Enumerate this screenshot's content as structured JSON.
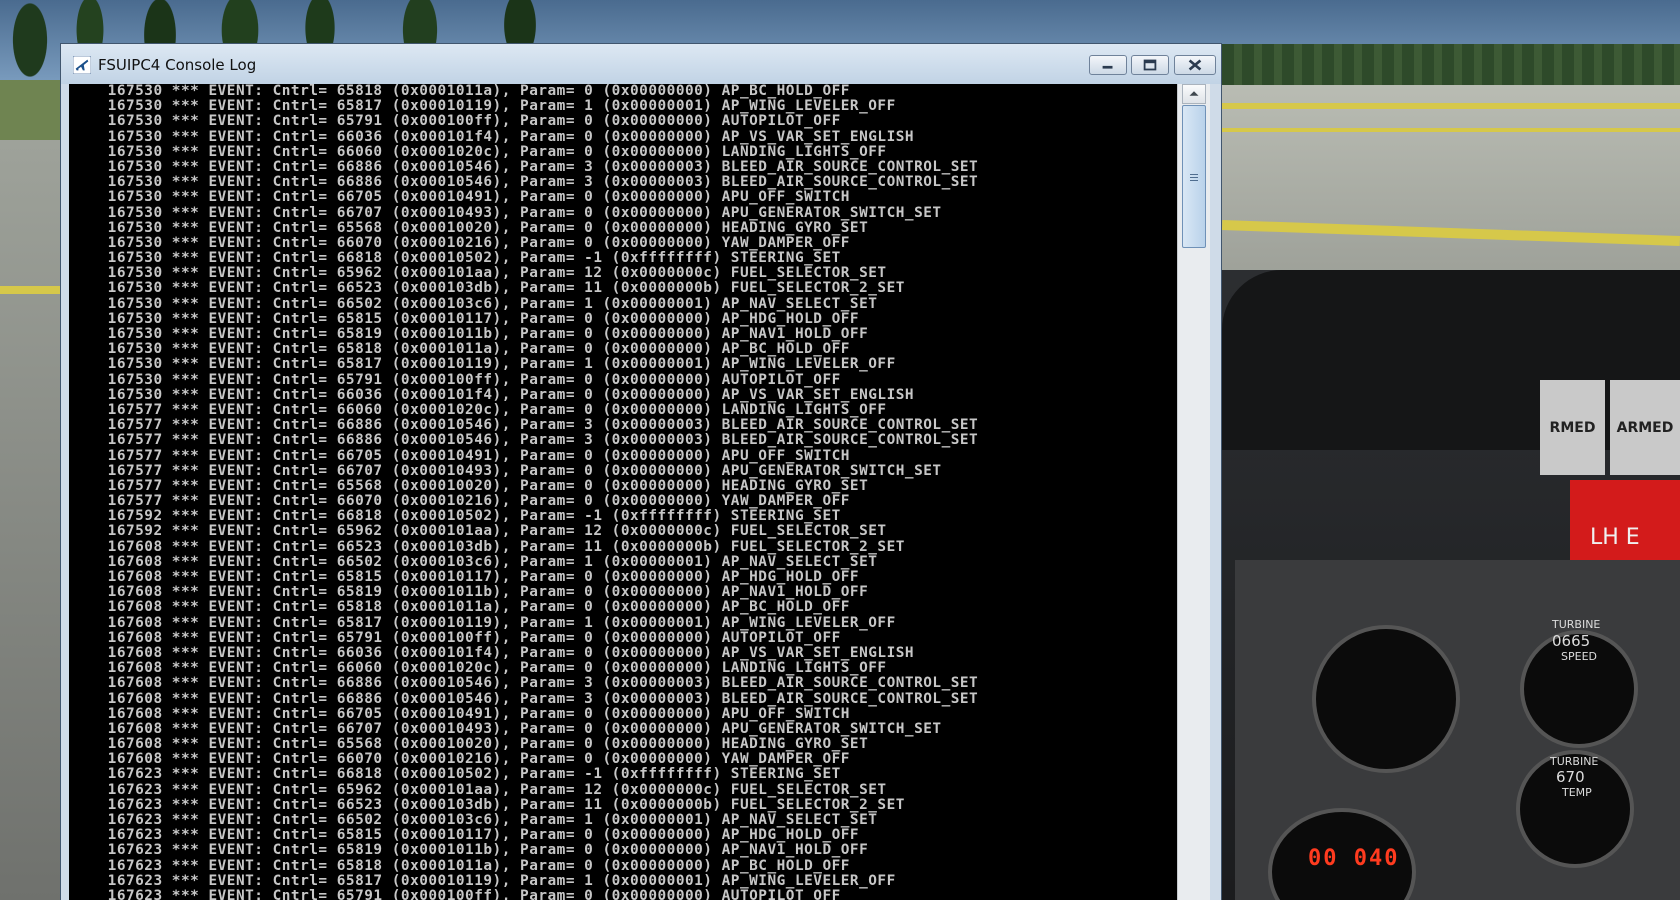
{
  "window": {
    "title": "FSUIPC4 Console Log",
    "icon": "airplane-icon",
    "controls": [
      "minimize-icon",
      "maximize-icon",
      "close-icon"
    ]
  },
  "background": {
    "panel_labels": {
      "armed_left": "RMED",
      "armed_right": "ARMED",
      "lh": "LH E",
      "gauge_turbine_speed": "TURBINE",
      "gauge_turbine_speed_sub": "SPEED",
      "gauge_turbine_speed_counter": "0665",
      "gauge_turbine_temp": "TURBINE",
      "gauge_turbine_temp_value": "670",
      "gauge_turbine_temp_sub": "TEMP",
      "altimeter_readout": "00 040"
    }
  },
  "console": {
    "lines": [
      "    167530 *** EVENT: Cntrl= 65818 (0x0001011a), Param= 0 (0x00000000) AP_BC_HOLD_OFF",
      "    167530 *** EVENT: Cntrl= 65817 (0x00010119), Param= 1 (0x00000001) AP_WING_LEVELER_OFF",
      "    167530 *** EVENT: Cntrl= 65791 (0x000100ff), Param= 0 (0x00000000) AUTOPILOT_OFF",
      "    167530 *** EVENT: Cntrl= 66036 (0x000101f4), Param= 0 (0x00000000) AP_VS_VAR_SET_ENGLISH",
      "    167530 *** EVENT: Cntrl= 66060 (0x0001020c), Param= 0 (0x00000000) LANDING_LIGHTS_OFF",
      "    167530 *** EVENT: Cntrl= 66886 (0x00010546), Param= 3 (0x00000003) BLEED_AIR_SOURCE_CONTROL_SET",
      "    167530 *** EVENT: Cntrl= 66886 (0x00010546), Param= 3 (0x00000003) BLEED_AIR_SOURCE_CONTROL_SET",
      "    167530 *** EVENT: Cntrl= 66705 (0x00010491), Param= 0 (0x00000000) APU_OFF_SWITCH",
      "    167530 *** EVENT: Cntrl= 66707 (0x00010493), Param= 0 (0x00000000) APU_GENERATOR_SWITCH_SET",
      "    167530 *** EVENT: Cntrl= 65568 (0x00010020), Param= 0 (0x00000000) HEADING_GYRO_SET",
      "    167530 *** EVENT: Cntrl= 66070 (0x00010216), Param= 0 (0x00000000) YAW_DAMPER_OFF",
      "    167530 *** EVENT: Cntrl= 66818 (0x00010502), Param= -1 (0xffffffff) STEERING_SET",
      "    167530 *** EVENT: Cntrl= 65962 (0x000101aa), Param= 12 (0x0000000c) FUEL_SELECTOR_SET",
      "    167530 *** EVENT: Cntrl= 66523 (0x000103db), Param= 11 (0x0000000b) FUEL_SELECTOR_2_SET",
      "    167530 *** EVENT: Cntrl= 66502 (0x000103c6), Param= 1 (0x00000001) AP_NAV_SELECT_SET",
      "    167530 *** EVENT: Cntrl= 65815 (0x00010117), Param= 0 (0x00000000) AP_HDG_HOLD_OFF",
      "    167530 *** EVENT: Cntrl= 65819 (0x0001011b), Param= 0 (0x00000000) AP_NAV1_HOLD_OFF",
      "    167530 *** EVENT: Cntrl= 65818 (0x0001011a), Param= 0 (0x00000000) AP_BC_HOLD_OFF",
      "    167530 *** EVENT: Cntrl= 65817 (0x00010119), Param= 1 (0x00000001) AP_WING_LEVELER_OFF",
      "    167530 *** EVENT: Cntrl= 65791 (0x000100ff), Param= 0 (0x00000000) AUTOPILOT_OFF",
      "    167530 *** EVENT: Cntrl= 66036 (0x000101f4), Param= 0 (0x00000000) AP_VS_VAR_SET_ENGLISH",
      "    167577 *** EVENT: Cntrl= 66060 (0x0001020c), Param= 0 (0x00000000) LANDING_LIGHTS_OFF",
      "    167577 *** EVENT: Cntrl= 66886 (0x00010546), Param= 3 (0x00000003) BLEED_AIR_SOURCE_CONTROL_SET",
      "    167577 *** EVENT: Cntrl= 66886 (0x00010546), Param= 3 (0x00000003) BLEED_AIR_SOURCE_CONTROL_SET",
      "    167577 *** EVENT: Cntrl= 66705 (0x00010491), Param= 0 (0x00000000) APU_OFF_SWITCH",
      "    167577 *** EVENT: Cntrl= 66707 (0x00010493), Param= 0 (0x00000000) APU_GENERATOR_SWITCH_SET",
      "    167577 *** EVENT: Cntrl= 65568 (0x00010020), Param= 0 (0x00000000) HEADING_GYRO_SET",
      "    167577 *** EVENT: Cntrl= 66070 (0x00010216), Param= 0 (0x00000000) YAW_DAMPER_OFF",
      "    167592 *** EVENT: Cntrl= 66818 (0x00010502), Param= -1 (0xffffffff) STEERING_SET",
      "    167592 *** EVENT: Cntrl= 65962 (0x000101aa), Param= 12 (0x0000000c) FUEL_SELECTOR_SET",
      "    167608 *** EVENT: Cntrl= 66523 (0x000103db), Param= 11 (0x0000000b) FUEL_SELECTOR_2_SET",
      "    167608 *** EVENT: Cntrl= 66502 (0x000103c6), Param= 1 (0x00000001) AP_NAV_SELECT_SET",
      "    167608 *** EVENT: Cntrl= 65815 (0x00010117), Param= 0 (0x00000000) AP_HDG_HOLD_OFF",
      "    167608 *** EVENT: Cntrl= 65819 (0x0001011b), Param= 0 (0x00000000) AP_NAV1_HOLD_OFF",
      "    167608 *** EVENT: Cntrl= 65818 (0x0001011a), Param= 0 (0x00000000) AP_BC_HOLD_OFF",
      "    167608 *** EVENT: Cntrl= 65817 (0x00010119), Param= 1 (0x00000001) AP_WING_LEVELER_OFF",
      "    167608 *** EVENT: Cntrl= 65791 (0x000100ff), Param= 0 (0x00000000) AUTOPILOT_OFF",
      "    167608 *** EVENT: Cntrl= 66036 (0x000101f4), Param= 0 (0x00000000) AP_VS_VAR_SET_ENGLISH",
      "    167608 *** EVENT: Cntrl= 66060 (0x0001020c), Param= 0 (0x00000000) LANDING_LIGHTS_OFF",
      "    167608 *** EVENT: Cntrl= 66886 (0x00010546), Param= 3 (0x00000003) BLEED_AIR_SOURCE_CONTROL_SET",
      "    167608 *** EVENT: Cntrl= 66886 (0x00010546), Param= 3 (0x00000003) BLEED_AIR_SOURCE_CONTROL_SET",
      "    167608 *** EVENT: Cntrl= 66705 (0x00010491), Param= 0 (0x00000000) APU_OFF_SWITCH",
      "    167608 *** EVENT: Cntrl= 66707 (0x00010493), Param= 0 (0x00000000) APU_GENERATOR_SWITCH_SET",
      "    167608 *** EVENT: Cntrl= 65568 (0x00010020), Param= 0 (0x00000000) HEADING_GYRO_SET",
      "    167608 *** EVENT: Cntrl= 66070 (0x00010216), Param= 0 (0x00000000) YAW_DAMPER_OFF",
      "    167623 *** EVENT: Cntrl= 66818 (0x00010502), Param= -1 (0xffffffff) STEERING_SET",
      "    167623 *** EVENT: Cntrl= 65962 (0x000101aa), Param= 12 (0x0000000c) FUEL_SELECTOR_SET",
      "    167623 *** EVENT: Cntrl= 66523 (0x000103db), Param= 11 (0x0000000b) FUEL_SELECTOR_2_SET",
      "    167623 *** EVENT: Cntrl= 66502 (0x000103c6), Param= 1 (0x00000001) AP_NAV_SELECT_SET",
      "    167623 *** EVENT: Cntrl= 65815 (0x00010117), Param= 0 (0x00000000) AP_HDG_HOLD_OFF",
      "    167623 *** EVENT: Cntrl= 65819 (0x0001011b), Param= 0 (0x00000000) AP_NAV1_HOLD_OFF",
      "    167623 *** EVENT: Cntrl= 65818 (0x0001011a), Param= 0 (0x00000000) AP_BC_HOLD_OFF",
      "    167623 *** EVENT: Cntrl= 65817 (0x00010119), Param= 1 (0x00000001) AP_WING_LEVELER_OFF",
      "    167623 *** EVENT: Cntrl= 65791 (0x000100ff), Param= 0 (0x00000000) AUTOPILOT_OFF"
    ]
  },
  "scrollbar": {
    "up_icon": "chevron-up-icon",
    "thumb_position": 0.0,
    "visible_fraction": 0.18
  },
  "colors": {
    "console_bg": "#000000",
    "console_text": "#c7c7c7",
    "titlebar": "#cfdbe8",
    "cockpit_red": "#d31b1b"
  }
}
